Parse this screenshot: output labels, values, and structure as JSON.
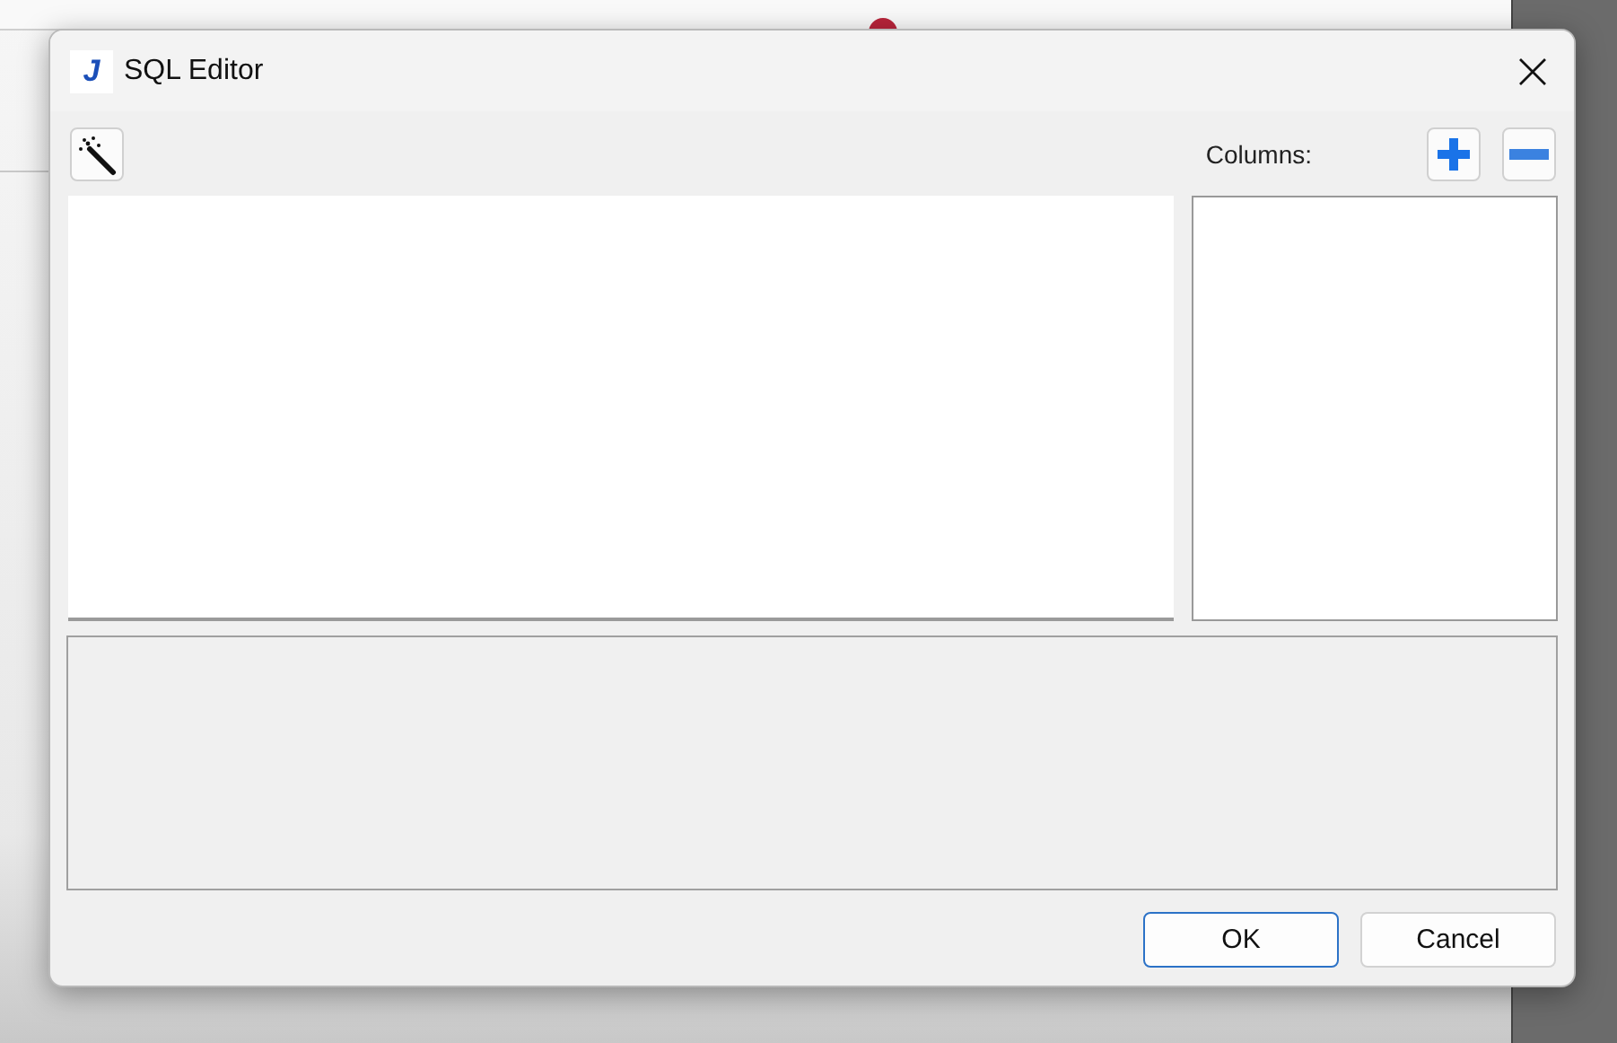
{
  "window": {
    "title": "SQL Editor",
    "icon_letter": "J"
  },
  "toolbar": {
    "columns_label": "Columns:"
  },
  "buttons": [
    {
      "label": "OK",
      "default": true
    },
    {
      "label": "Cancel",
      "default": false
    }
  ]
}
